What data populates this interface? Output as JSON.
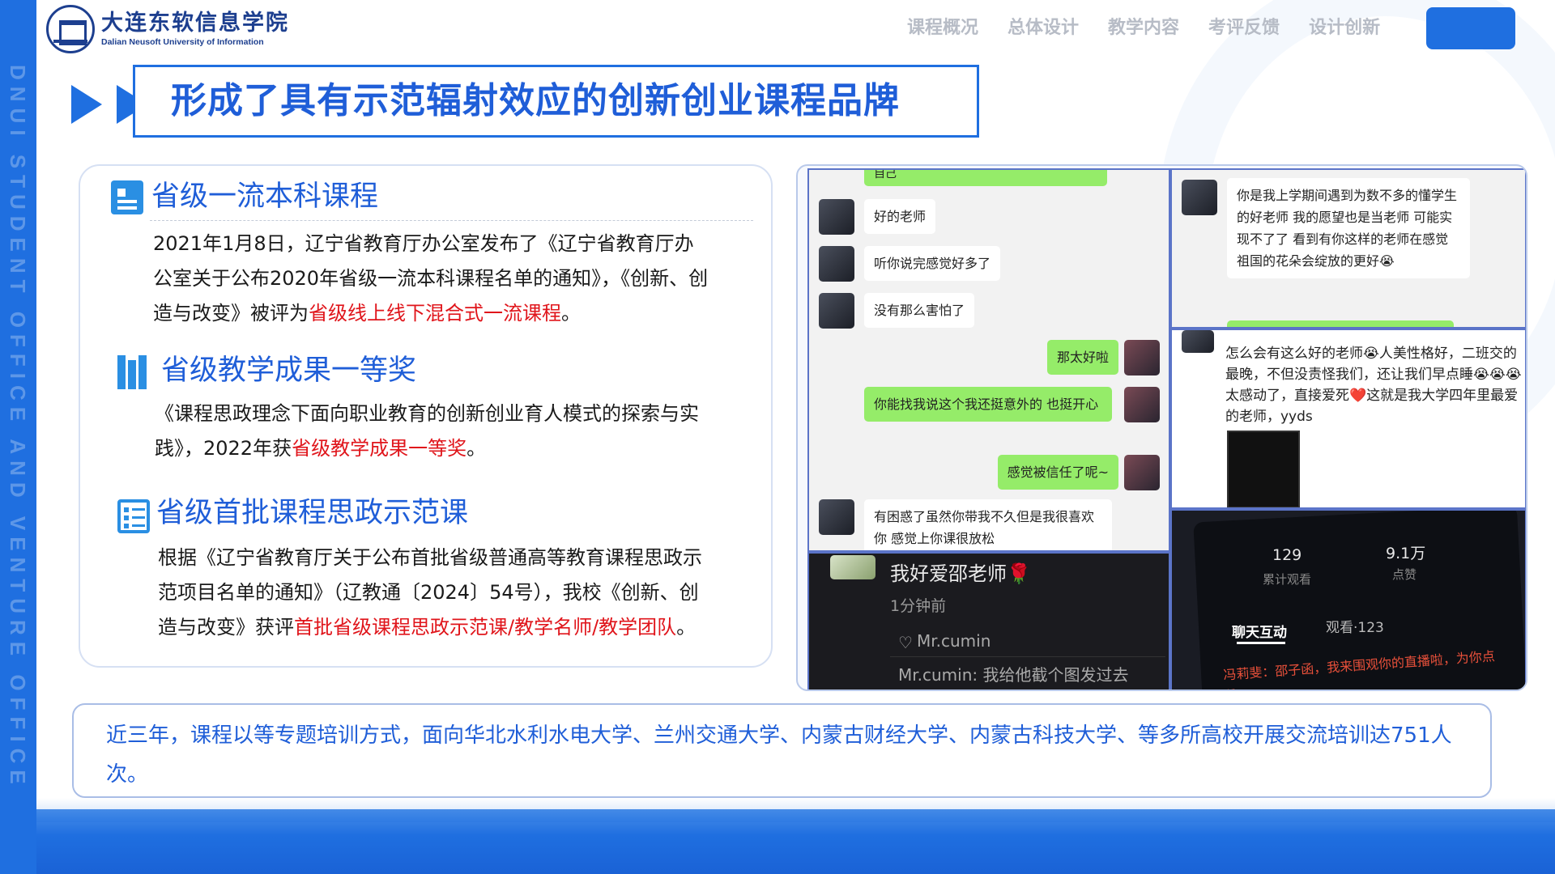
{
  "side_watermark": "DNUI STUDENT OFFICE AND VENTURE OFFICE",
  "logo": {
    "cn": "大连东软信息学院",
    "en": "Dalian Neusoft University of Information"
  },
  "nav": {
    "items": [
      "课程概况",
      "总体设计",
      "教学内容",
      "考评反馈",
      "设计创新"
    ]
  },
  "title": "形成了具有示范辐射效应的创新创业课程品牌",
  "sections": [
    {
      "heading": "省级一流本科课程",
      "text_before": "2021年1月8日，辽宁省教育厅办公室发布了《辽宁省教育厅办公室关于公布2020年省级一流本科课程名单的通知》，《创新、创造与改变》被评为",
      "highlight": "省级线上线下混合式一流课程",
      "text_after": "。"
    },
    {
      "heading": "省级教学成果一等奖",
      "text_before": "《课程思政理念下面向职业教育的创新创业育人模式的探索与实践》，2022年获",
      "highlight": "省级教学成果一等奖",
      "text_after": "。"
    },
    {
      "heading": "省级首批课程思政示范课",
      "text_before": "根据《辽宁省教育厅关于公布首批省级普通高等教育课程思政示范项目名单的通知》（辽教通〔2024〕54号），我校《创新、创造与改变》获评",
      "highlight": "首批省级课程思政示范课/教学名师/教学团队",
      "text_after": "。"
    }
  ],
  "chat1": {
    "top_partial": "自己",
    "messages": [
      {
        "side": "left",
        "text": "好的老师"
      },
      {
        "side": "left",
        "text": "听你说完感觉好多了"
      },
      {
        "side": "left",
        "text": "没有那么害怕了"
      },
      {
        "side": "right",
        "text": "那太好啦"
      },
      {
        "side": "right",
        "text": "你能找我说这个我还挺意外的 也挺开心"
      },
      {
        "side": "right",
        "text": "感觉被信任了呢~"
      },
      {
        "side": "left",
        "text": "有困惑了虽然你带我不久但是我很喜欢你 感觉上你课很放松"
      }
    ]
  },
  "chat2": {
    "message": "你是我上学期间遇到为数不多的懂学生的好老师 我的愿望也是当老师 可能实现不了了 看到有你这样的老师在感觉祖国的花朵会绽放的更好😭"
  },
  "chat3": {
    "message": "怎么会有这么好的老师😭人美性格好，二班交的最晚，不但没责怪我们，还让我们早点睡😭😭😭太感动了，直接爱死❤️这就是我大学四年里最爱的老师，yyds"
  },
  "comment": {
    "text": "我好爱邵老师🌹",
    "time": "1分钟前",
    "like_user": "Mr.cumin",
    "reply": "Mr.cumin: 我给他截个图发过去"
  },
  "live": {
    "views": "129",
    "views_label": "累计观看",
    "likes": "9.1万",
    "likes_label": "点赞",
    "tab_active": "聊天互动",
    "tab_other": "观看·123",
    "chat_line": "冯莉斐：邵子函，我来围观你的直播啦，为你点赞！"
  },
  "bottom_text": "近三年，课程以等专题培训方式，面向华北水利水电大学、兰州交通大学、内蒙古财经大学、内蒙古科技大学、等多所高校开展交流培训达751人次。",
  "colors": {
    "brand_blue": "#1f6fe0",
    "heading_blue": "#1f5ed8",
    "highlight_red": "#e0151b",
    "wechat_green": "#95ec69"
  }
}
